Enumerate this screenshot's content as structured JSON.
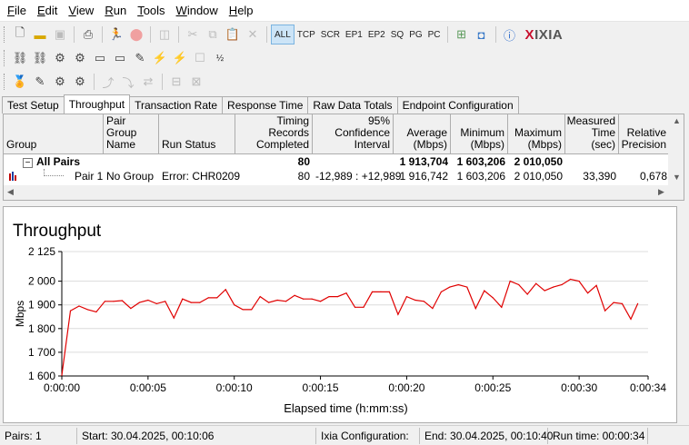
{
  "menu": [
    "File",
    "Edit",
    "View",
    "Run",
    "Tools",
    "Window",
    "Help"
  ],
  "menu_underline": [
    "F",
    "E",
    "V",
    "R",
    "T",
    "W",
    "H"
  ],
  "toolbar": {
    "filters": [
      "ALL",
      "TCP",
      "SCR",
      "EP1",
      "EP2",
      "SQ",
      "PG",
      "PC"
    ],
    "selected_filter": "ALL",
    "logo_x": "X",
    "logo_rest": "IXIA"
  },
  "tabs": [
    "Test Setup",
    "Throughput",
    "Transaction Rate",
    "Response Time",
    "Raw Data Totals",
    "Endpoint Configuration"
  ],
  "active_tab": "Throughput",
  "table": {
    "headers": [
      [
        "Group"
      ],
      [
        "Pair Group",
        "Name"
      ],
      [
        "Run Status"
      ],
      [
        "Timing Records",
        "Completed"
      ],
      [
        "95% Confidence",
        "Interval"
      ],
      [
        "Average",
        "(Mbps)"
      ],
      [
        "Minimum",
        "(Mbps)"
      ],
      [
        "Maximum",
        "(Mbps)"
      ],
      [
        "Measured",
        "Time (sec)"
      ],
      [
        "Relative",
        "Precision"
      ]
    ],
    "summary_row": {
      "expander": "−",
      "label": "All Pairs",
      "records": "80",
      "average": "1 913,704",
      "minimum": "1 603,206",
      "maximum": "2 010,050"
    },
    "pair_row": {
      "label": "Pair 1",
      "group": "No Group",
      "status": "Error:  CHR0209",
      "records": "80",
      "confidence": "-12,989 : +12,989",
      "average": "1 916,742",
      "minimum": "1 603,206",
      "maximum": "2 010,050",
      "measured": "33,390",
      "precision": "0,678"
    }
  },
  "chart_data": {
    "type": "line",
    "title": "Throughput",
    "xlabel": "Elapsed time (h:mm:ss)",
    "ylabel": "Mbps",
    "ylim": [
      1600,
      2125
    ],
    "xlim": [
      0,
      34
    ],
    "yticks": [
      1600,
      1700,
      1800,
      1900,
      2000,
      2125
    ],
    "ytick_labels": [
      "1 600",
      "1 700",
      "1 800",
      "1 900",
      "2 000",
      "2 125"
    ],
    "xticks": [
      0,
      5,
      10,
      15,
      20,
      25,
      30,
      34
    ],
    "xtick_labels": [
      "0:00:00",
      "0:00:05",
      "0:00:10",
      "0:00:15",
      "0:00:20",
      "0:00:25",
      "0:00:30",
      "0:00:34"
    ],
    "grid": "horizontal",
    "line_color": "#e00000",
    "series": [
      {
        "x": [
          0,
          0.5,
          1.0,
          1.5,
          2.0,
          2.5,
          3.0,
          3.5,
          4.0,
          4.5,
          5.0,
          5.5,
          6.0,
          6.5,
          7.0,
          7.5,
          8.0,
          8.5,
          9.0,
          9.5,
          10.0,
          10.5,
          11.0,
          11.5,
          12.0,
          12.5,
          13.0,
          13.5,
          14.0,
          14.5,
          15.0,
          15.5,
          16.0,
          16.5,
          17.0,
          17.5,
          18.0,
          18.5,
          19.0,
          19.5,
          20.0,
          20.5,
          21.0,
          21.5,
          22.0,
          22.5,
          23.0,
          23.5,
          24.0,
          24.5,
          25.0,
          25.5,
          26.0,
          26.5,
          27.0,
          27.5,
          28.0,
          28.5,
          29.0,
          29.5,
          30.0,
          30.5,
          31.0,
          31.5,
          32.0,
          32.5,
          33.0,
          33.4
        ],
        "y": [
          1603,
          1875,
          1895,
          1880,
          1870,
          1915,
          1915,
          1918,
          1885,
          1910,
          1920,
          1905,
          1915,
          1845,
          1925,
          1910,
          1910,
          1930,
          1930,
          1965,
          1900,
          1880,
          1880,
          1935,
          1910,
          1920,
          1915,
          1940,
          1925,
          1925,
          1915,
          1935,
          1935,
          1950,
          1890,
          1890,
          1955,
          1955,
          1955,
          1860,
          1935,
          1920,
          1915,
          1885,
          1955,
          1975,
          1985,
          1975,
          1885,
          1960,
          1930,
          1890,
          2000,
          1985,
          1945,
          1990,
          1960,
          1975,
          1985,
          2008,
          2000,
          1950,
          1982,
          1875,
          1910,
          1905,
          1840,
          1905
        ]
      }
    ]
  },
  "status": {
    "pairs": "Pairs: 1",
    "start": "Start: 30.04.2025, 00:10:06",
    "config": "Ixia Configuration:",
    "end": "End: 30.04.2025, 00:10:40",
    "runtime": "Run time: 00:00:34"
  }
}
